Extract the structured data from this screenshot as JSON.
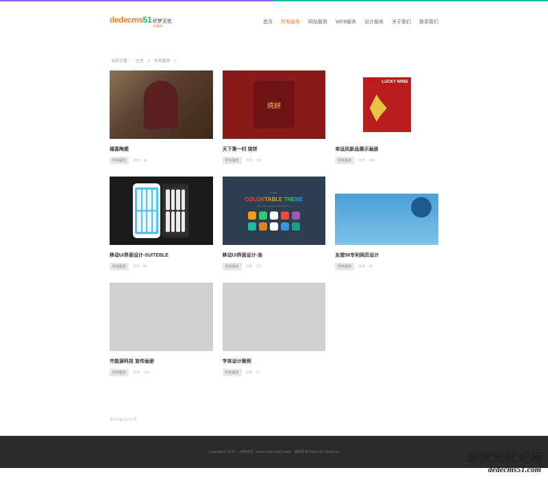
{
  "logo": {
    "text1": "dedecms",
    "text2": "51",
    "cn": "织梦无忧",
    "com": ".com"
  },
  "nav": [
    {
      "label": "首页",
      "active": false
    },
    {
      "label": "所有服务",
      "active": true
    },
    {
      "label": "网站服务",
      "active": false
    },
    {
      "label": "WEB服务",
      "active": false
    },
    {
      "label": "设计服务",
      "active": false
    },
    {
      "label": "关于我们",
      "active": false
    },
    {
      "label": "联系我们",
      "active": false
    }
  ],
  "breadcrumb": {
    "prefix": "当前位置：",
    "home": "主页",
    "sep": ">",
    "current": "所有服务"
  },
  "cards": [
    {
      "title": "福喜陶瓷",
      "tag": "所有服务",
      "views_label": "浏览：",
      "views": "38"
    },
    {
      "title": "天下第一村 烧饼",
      "tag": "所有服务",
      "views_label": "浏览：",
      "views": "162"
    },
    {
      "title": "幸运风新品展示画册",
      "tag": "所有服务",
      "views_label": "浏览：",
      "views": "180"
    },
    {
      "title": "移动UI界面设计-SUITEBLE",
      "tag": "所有服务",
      "views_label": "浏览：",
      "views": "86"
    },
    {
      "title": "移动UI界面设计-浩",
      "tag": "所有服务",
      "views_label": "浏览：",
      "views": "119"
    },
    {
      "title": "友盟56专利网页设计",
      "tag": "所有服务",
      "views_label": "浏览：",
      "views": "98"
    },
    {
      "title": "齐能源科技 宣传画册",
      "tag": "所有服务",
      "views_label": "浏览：",
      "views": "109"
    },
    {
      "title": "字体设计案例",
      "tag": "所有服务",
      "views_label": "浏览：",
      "views": "63"
    }
  ],
  "img3": {
    "lucky": "LUCKY WIND"
  },
  "img5": {
    "pre": "THE",
    "main": "COLORTABLE THEME",
    "sub": "Does this colour suit my complexion"
  },
  "filing": "京ICP备XXXXX号",
  "footer": "Copyright © 2015 ；织梦无忧（www.dedecms51.com） 版权所有 Power by DedeCms",
  "watermark": {
    "line1": "织梦无忧论坛",
    "line2": "dedecms51.com"
  }
}
